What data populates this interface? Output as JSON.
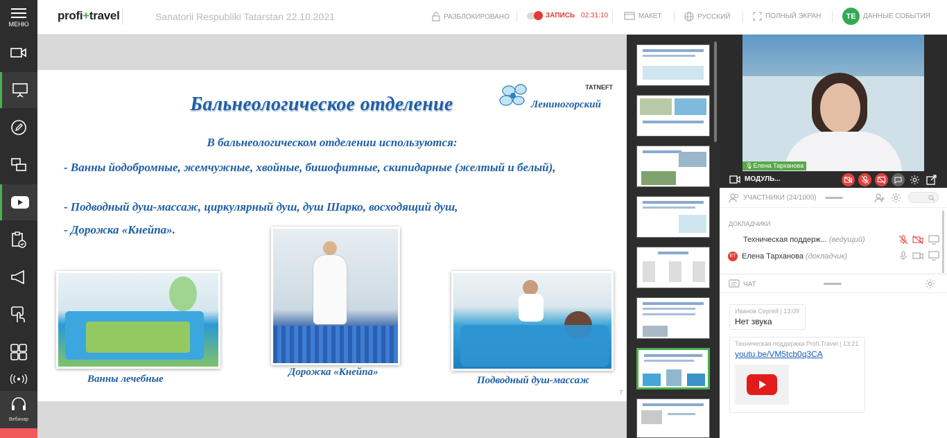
{
  "topbar": {
    "menu_label": "МЕНЮ",
    "logo_left": "profi",
    "logo_plus": "+",
    "logo_right": "travel",
    "event_title": "Sanatorii Respubliki Tatarstan 22.10.2021",
    "unlocked": "РАЗБЛОКИРОВАНО",
    "record": "ЗАПИСЬ",
    "timer": "02:31:10",
    "layout": "МАКЕТ",
    "language": "РУССКИЙ",
    "fullscreen": "ПОЛНЫЙ ЭКРАН",
    "avatar": "TE",
    "event_data": "ДАННЫЕ СОБЫТИЯ"
  },
  "sidebar": {
    "items": [
      "camera-icon",
      "presentation-icon",
      "pen-icon",
      "screen-share-icon",
      "youtube-icon",
      "clipboard-check-icon",
      "megaphone-icon",
      "touch-icon",
      "layout-grid-icon",
      "broadcast-icon"
    ],
    "bottom_label": "Вебинар"
  },
  "slide": {
    "title": "Бальнеологическое отделение",
    "logo_brand": "TATNEFT",
    "logo_name": "Лениногорский",
    "subtitle": "В бальнеологическом отделении используются:",
    "bullet1": "-   Ванны йодобромные,     жемчужные, хвойные, бишофитные, скипидарные (желтый и белый),",
    "bullet2": "-   Подводный душ-массаж, циркулярный душ, душ Шарко, восходящий душ,",
    "bullet3": "-   Дорожка «Кнейпа».",
    "captions": [
      "Ванны лечебные",
      "Дорожка «Кнейпа»",
      "Подводный душ-массаж"
    ],
    "page_number": "7"
  },
  "video": {
    "speaker_name": "Елена Тарханова",
    "module_label": "МОДУЛЬ..."
  },
  "participants": {
    "header": "УЧАСТНИКИ (24/1000)",
    "group": "ДОКЛАДЧИКИ",
    "rows": [
      {
        "name": "Техническая поддерж...",
        "role": "(ведущий)"
      },
      {
        "initials": "ET",
        "name": "Елена Тарханова",
        "role": "(докладчик)"
      }
    ]
  },
  "chat": {
    "header": "ЧАТ",
    "messages": [
      {
        "author": "Иванов Сергей",
        "time": "13:09",
        "text": "Нет звука"
      },
      {
        "author": "Техническая поддержка Profi.Travel",
        "time": "13:21",
        "link": "youtu.be/VM5tcb0q3CA"
      }
    ]
  },
  "colors": {
    "accent_green": "#49b04f",
    "record_red": "#e53935",
    "slide_blue": "#1f5fa6",
    "dark_panel": "#2d2d2d"
  }
}
